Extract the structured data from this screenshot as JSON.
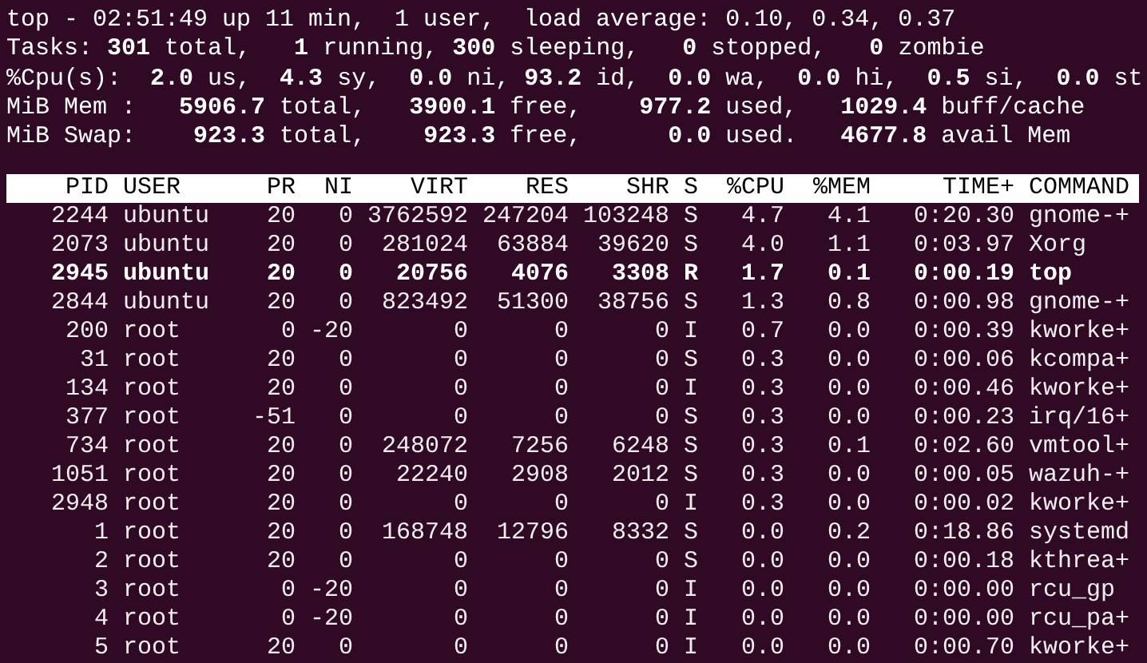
{
  "summary_lines": [
    "top - 02:51:49 up 11 min,  1 user,  load average: 0.10, 0.34, 0.37",
    "Tasks: **301** total,   **1** running, **300** sleeping,   **0** stopped,   **0** zombie",
    "%Cpu(s):  **2.0** us,  **4.3** sy,  **0.0** ni, **93.2** id,  **0.0** wa,  **0.0** hi,  **0.5** si,  **0.0** st",
    "MiB Mem :   **5906.7** total,   **3900.1** free,    **977.2** used,   **1029.4** buff/cache",
    "MiB Swap:    **923.3** total,    **923.3** free,      **0.0** used.   **4677.8** avail Mem"
  ],
  "table": {
    "columns": [
      "PID",
      "USER",
      "PR",
      "NI",
      "VIRT",
      "RES",
      "SHR",
      "S",
      "%CPU",
      "%MEM",
      "TIME+",
      "COMMAND"
    ],
    "rows": [
      {
        "highlighted": false,
        "cells": [
          "2244",
          "ubuntu",
          "20",
          "0",
          "3762592",
          "247204",
          "103248",
          "S",
          "4.7",
          "4.1",
          "0:20.30",
          "gnome-+"
        ]
      },
      {
        "highlighted": false,
        "cells": [
          "2073",
          "ubuntu",
          "20",
          "0",
          "281024",
          "63884",
          "39620",
          "S",
          "4.0",
          "1.1",
          "0:03.97",
          "Xorg"
        ]
      },
      {
        "highlighted": true,
        "cells": [
          "2945",
          "ubuntu",
          "20",
          "0",
          "20756",
          "4076",
          "3308",
          "R",
          "1.7",
          "0.1",
          "0:00.19",
          "top"
        ]
      },
      {
        "highlighted": false,
        "cells": [
          "2844",
          "ubuntu",
          "20",
          "0",
          "823492",
          "51300",
          "38756",
          "S",
          "1.3",
          "0.8",
          "0:00.98",
          "gnome-+"
        ]
      },
      {
        "highlighted": false,
        "cells": [
          "200",
          "root",
          "0",
          "-20",
          "0",
          "0",
          "0",
          "I",
          "0.7",
          "0.0",
          "0:00.39",
          "kworke+"
        ]
      },
      {
        "highlighted": false,
        "cells": [
          "31",
          "root",
          "20",
          "0",
          "0",
          "0",
          "0",
          "S",
          "0.3",
          "0.0",
          "0:00.06",
          "kcompa+"
        ]
      },
      {
        "highlighted": false,
        "cells": [
          "134",
          "root",
          "20",
          "0",
          "0",
          "0",
          "0",
          "I",
          "0.3",
          "0.0",
          "0:00.46",
          "kworke+"
        ]
      },
      {
        "highlighted": false,
        "cells": [
          "377",
          "root",
          "-51",
          "0",
          "0",
          "0",
          "0",
          "S",
          "0.3",
          "0.0",
          "0:00.23",
          "irq/16+"
        ]
      },
      {
        "highlighted": false,
        "cells": [
          "734",
          "root",
          "20",
          "0",
          "248072",
          "7256",
          "6248",
          "S",
          "0.3",
          "0.1",
          "0:02.60",
          "vmtool+"
        ]
      },
      {
        "highlighted": false,
        "cells": [
          "1051",
          "root",
          "20",
          "0",
          "22240",
          "2908",
          "2012",
          "S",
          "0.3",
          "0.0",
          "0:00.05",
          "wazuh-+"
        ]
      },
      {
        "highlighted": false,
        "cells": [
          "2948",
          "root",
          "20",
          "0",
          "0",
          "0",
          "0",
          "I",
          "0.3",
          "0.0",
          "0:00.02",
          "kworke+"
        ]
      },
      {
        "highlighted": false,
        "cells": [
          "1",
          "root",
          "20",
          "0",
          "168748",
          "12796",
          "8332",
          "S",
          "0.0",
          "0.2",
          "0:18.86",
          "systemd"
        ]
      },
      {
        "highlighted": false,
        "cells": [
          "2",
          "root",
          "20",
          "0",
          "0",
          "0",
          "0",
          "S",
          "0.0",
          "0.0",
          "0:00.18",
          "kthrea+"
        ]
      },
      {
        "highlighted": false,
        "cells": [
          "3",
          "root",
          "0",
          "-20",
          "0",
          "0",
          "0",
          "I",
          "0.0",
          "0.0",
          "0:00.00",
          "rcu_gp"
        ]
      },
      {
        "highlighted": false,
        "cells": [
          "4",
          "root",
          "0",
          "-20",
          "0",
          "0",
          "0",
          "I",
          "0.0",
          "0.0",
          "0:00.00",
          "rcu_pa+"
        ]
      },
      {
        "highlighted": false,
        "cells": [
          "5",
          "root",
          "20",
          "0",
          "0",
          "0",
          "0",
          "I",
          "0.0",
          "0.0",
          "0:00.70",
          "kworke+"
        ]
      }
    ]
  }
}
